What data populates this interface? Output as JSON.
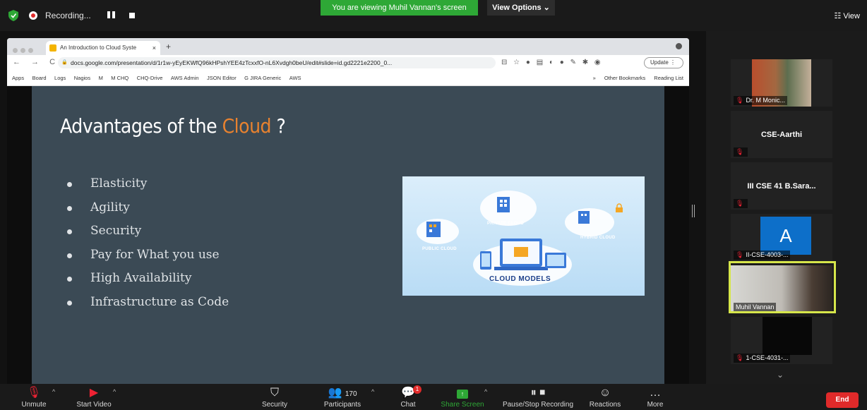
{
  "topbar": {
    "recording_label": "Recording...",
    "viewing_banner": "You are viewing Muhil Vannan's screen",
    "view_options": "View Options ⌄",
    "view_button": "☷ View"
  },
  "browser": {
    "tab_title": "An Introduction to Cloud Syste",
    "tab_close": "×",
    "new_tab": "+",
    "nav": "← → C",
    "url": "docs.google.com/presentation/d/1r1w-yEyEKWfQ96kHPshYEE4zTcxxfO-nL6Xvdgh0beU/edit#slide=id.gd2221e2200_0...",
    "update_label": "Update ⋮",
    "bookmarks": [
      "Apps",
      "Board",
      "Logs",
      "Nagios",
      "M",
      "M CHQ",
      "CHQ-Drive",
      "AWS Admin",
      "JSON Editor",
      "G JIRA Generic",
      "AWS"
    ],
    "bookmarks_right": [
      "»",
      "Other Bookmarks",
      "Reading List"
    ]
  },
  "slide": {
    "title_prefix": "Advantages of the",
    "title_accent": "Cloud",
    "title_suffix": "?",
    "bullets": [
      "Elasticity",
      "Agility",
      "Security",
      "Pay for What you use",
      "High Availability",
      "Infrastructure as Code"
    ],
    "image_labels": {
      "private": "PRIVATE CLOUD",
      "public": "PUBLIC CLOUD",
      "hybrid": "HYBRID CLOUD",
      "models": "CLOUD MODELS"
    }
  },
  "participants": [
    {
      "name": "Dr. M Monic...",
      "muted": true
    },
    {
      "name": "CSE-Aarthi",
      "muted": true
    },
    {
      "name": "III CSE 41 B.Sara...",
      "muted": true
    },
    {
      "name": "II-CSE-4003-...",
      "muted": true,
      "avatar": "A"
    },
    {
      "name": "Muhil Vannan",
      "muted": false
    },
    {
      "name": "1-CSE-4031-...",
      "muted": true
    }
  ],
  "toolbar": {
    "unmute": "Unmute",
    "start_video": "Start Video",
    "security": "Security",
    "participants": "Participants",
    "participants_count": "170",
    "chat": "Chat",
    "chat_badge": "1",
    "share_screen": "Share Screen",
    "pause_recording": "Pause/Stop Recording",
    "reactions": "Reactions",
    "more": "More",
    "end": "End"
  }
}
